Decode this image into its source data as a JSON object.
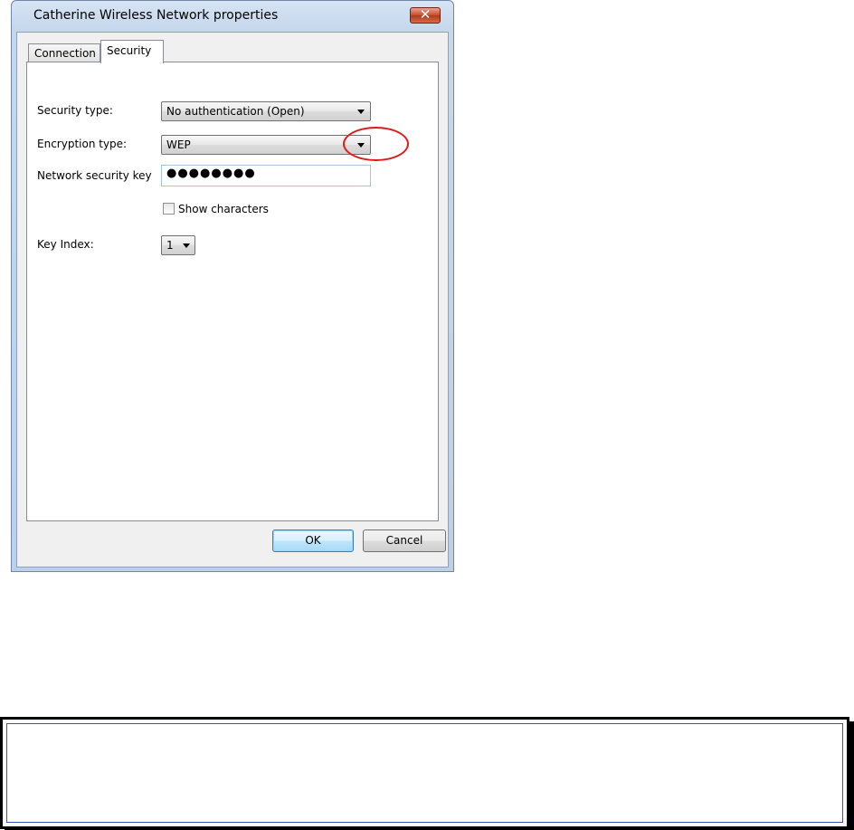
{
  "window": {
    "title": "Catherine  Wireless Network properties",
    "close_glyph": "✕"
  },
  "tabs": [
    {
      "label": "Connection",
      "active": false
    },
    {
      "label": "Security",
      "active": true
    }
  ],
  "fields": {
    "security_type": {
      "label": "Security type:",
      "value": "No authentication (Open)"
    },
    "encryption_type": {
      "label": "Encryption type:",
      "value": "WEP"
    },
    "network_key": {
      "label": "Network security key",
      "value": "●●●●●●●●"
    },
    "show_characters": {
      "label": "Show characters",
      "checked": false
    },
    "key_index": {
      "label": "Key Index:",
      "value": "1"
    }
  },
  "buttons": {
    "ok": "OK",
    "cancel": "Cancel"
  },
  "annotation": {
    "highlight_color": "#e01818"
  }
}
